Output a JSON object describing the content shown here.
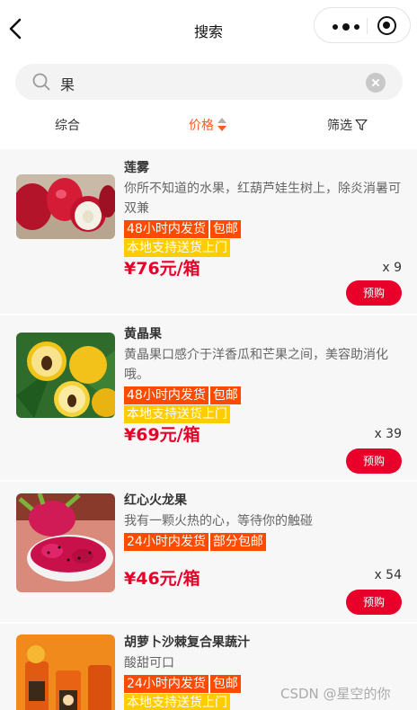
{
  "header": {
    "title": "搜索"
  },
  "search": {
    "value": "果"
  },
  "sortbar": {
    "items": [
      "综合",
      "价格",
      "筛选"
    ]
  },
  "products": [
    {
      "name": "莲雾",
      "desc": "你所不知道的水果，红葫芦娃生树上，除炎消暑可双兼",
      "tags": [
        {
          "text": "48小时内发货",
          "color": "orange"
        },
        {
          "text": "包邮",
          "color": "orange"
        },
        {
          "text": "本地支持送货上门",
          "color": "yellow"
        }
      ],
      "price": "¥76元/箱",
      "qty": "x 9",
      "button": "预购"
    },
    {
      "name": "黄晶果",
      "desc": "黄晶果口感介于洋香瓜和芒果之间，美容助消化哦。",
      "tags": [
        {
          "text": "48小时内发货",
          "color": "orange"
        },
        {
          "text": "包邮",
          "color": "orange"
        },
        {
          "text": "本地支持送货上门",
          "color": "yellow"
        }
      ],
      "price": "¥69元/箱",
      "qty": "x 39",
      "button": "预购"
    },
    {
      "name": "红心火龙果",
      "desc": "我有一颗火热的心，等待你的触碰",
      "tags": [
        {
          "text": "24小时内发货",
          "color": "orange"
        },
        {
          "text": "部分包邮",
          "color": "orange"
        }
      ],
      "price": "¥46元/箱",
      "qty": "x 54",
      "button": "预购"
    },
    {
      "name": "胡萝卜沙棘复合果蔬汁",
      "desc": "酸甜可口",
      "tags": [
        {
          "text": "24小时内发货",
          "color": "orange"
        },
        {
          "text": "包邮",
          "color": "orange"
        },
        {
          "text": "本地支持送货上门",
          "color": "yellow"
        }
      ],
      "price": "",
      "qty": "",
      "button": ""
    }
  ],
  "watermark": "CSDN @星空的你",
  "colors": {
    "accent": "#ff5a1e",
    "price": "#e8002a",
    "tag_orange": "#ff4b00",
    "tag_yellow": "#ffcc00"
  },
  "icons": [
    "back-arrow-icon",
    "more-dots-icon",
    "target-icon",
    "search-icon",
    "clear-icon",
    "sort-arrows-icon",
    "filter-icon"
  ]
}
